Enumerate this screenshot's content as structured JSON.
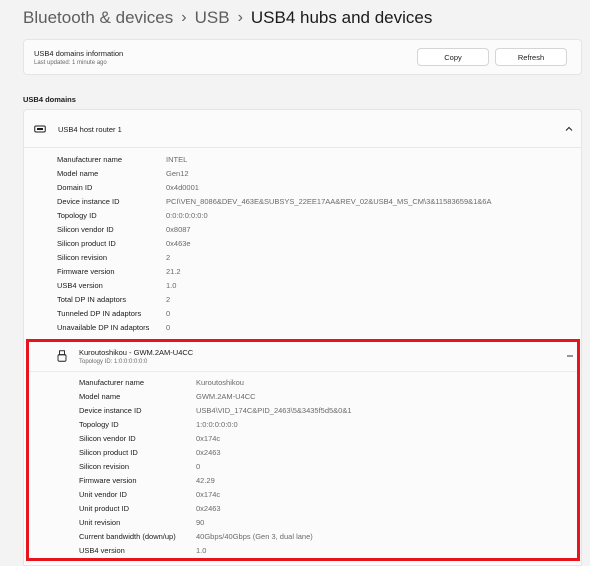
{
  "breadcrumb": {
    "item1": "Bluetooth & devices",
    "item2": "USB",
    "current": "USB4 hubs and devices",
    "separator": "›"
  },
  "info": {
    "title": "USB4 domains information",
    "last_updated": "Last updated: 1 minute ago",
    "copy_label": "Copy",
    "refresh_label": "Refresh"
  },
  "section_label": "USB4 domains",
  "router": {
    "title": "USB4 host router 1",
    "icon": "router-icon",
    "properties": [
      {
        "label": "Manufacturer name",
        "value": "INTEL"
      },
      {
        "label": "Model name",
        "value": "Gen12"
      },
      {
        "label": "Domain ID",
        "value": "0x4d0001"
      },
      {
        "label": "Device instance ID",
        "value": "PCI\\VEN_8086&DEV_463E&SUBSYS_22EE17AA&REV_02&USB4_MS_CM\\3&11583659&1&6A"
      },
      {
        "label": "Topology ID",
        "value": "0:0:0:0:0:0:0"
      },
      {
        "label": "Silicon vendor ID",
        "value": "0x8087"
      },
      {
        "label": "Silicon product ID",
        "value": "0x463e"
      },
      {
        "label": "Silicon revision",
        "value": "2"
      },
      {
        "label": "Firmware version",
        "value": "21.2"
      },
      {
        "label": "USB4 version",
        "value": "1.0"
      },
      {
        "label": "Total DP IN adaptors",
        "value": "2"
      },
      {
        "label": "Tunneled DP IN adaptors",
        "value": "0"
      },
      {
        "label": "Unavailable DP IN adaptors",
        "value": "0"
      }
    ]
  },
  "device": {
    "title": "Kuroutoshikou - GWM.2AM-U4CC",
    "topology": "Topology ID:  1:0:0:0:0:0:0",
    "properties": [
      {
        "label": "Manufacturer name",
        "value": "Kuroutoshikou"
      },
      {
        "label": "Model name",
        "value": "GWM.2AM-U4CC"
      },
      {
        "label": "Device instance ID",
        "value": "USB4\\VID_174C&PID_2463\\5&3435f5d5&0&1"
      },
      {
        "label": "Topology ID",
        "value": "1:0:0:0:0:0:0"
      },
      {
        "label": "Silicon vendor ID",
        "value": "0x174c"
      },
      {
        "label": "Silicon product ID",
        "value": "0x2463"
      },
      {
        "label": "Silicon revision",
        "value": "0"
      },
      {
        "label": "Firmware version",
        "value": "42.29"
      },
      {
        "label": "Unit vendor ID",
        "value": "0x174c"
      },
      {
        "label": "Unit product ID",
        "value": "0x2463"
      },
      {
        "label": "Unit revision",
        "value": "90"
      },
      {
        "label": "Current bandwidth (down/up)",
        "value": "40Gbps/40Gbps (Gen 3, dual lane)"
      },
      {
        "label": "USB4 version",
        "value": "1.0"
      }
    ]
  },
  "colors": {
    "highlight": "#e8141b",
    "background": "#f3f3f3",
    "card": "#fbfbfb"
  }
}
